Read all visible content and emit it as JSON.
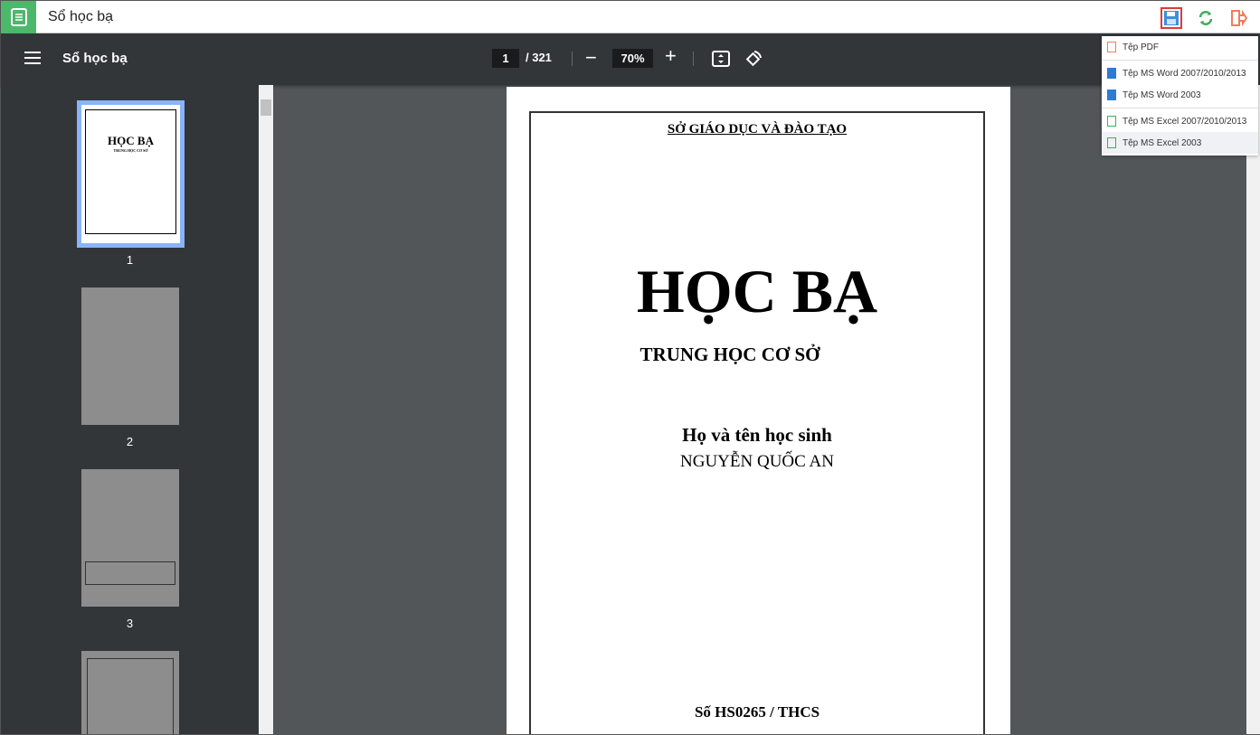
{
  "app": {
    "title": "Sổ học bạ",
    "icon": "document-icon"
  },
  "toolbar": {
    "doc_title": "Sổ học bạ",
    "page": "1",
    "total": "/ 321",
    "zoom": "70%"
  },
  "export_menu": {
    "items": [
      {
        "label": "Tệp PDF",
        "icon": "pdf-icon",
        "color": "#f47a5b"
      },
      {
        "label": "Tệp MS Word 2007/2010/2013",
        "icon": "word-icon",
        "color": "#2b7cd3"
      },
      {
        "label": "Tệp MS Word 2003",
        "icon": "word-icon",
        "color": "#2b7cd3"
      },
      {
        "label": "Tệp MS Excel 2007/2010/2013",
        "icon": "excel-icon",
        "color": "#3fae5a"
      },
      {
        "label": "Tệp MS Excel 2003",
        "icon": "excel-icon",
        "color": "#3fae5a"
      }
    ]
  },
  "thumbnails": [
    "1",
    "2",
    "3"
  ],
  "document": {
    "dept": "SỞ GIÁO DỤC VÀ ĐÀO TẠO",
    "title": "HỌC BẠ",
    "level": "TRUNG HỌC CƠ SỞ",
    "name_label": "Họ và tên học sinh",
    "name": "NGUYỄN QUỐC AN",
    "number": "Số HS0265 / THCS"
  }
}
